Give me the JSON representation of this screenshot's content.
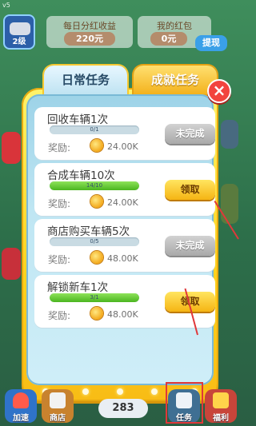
{
  "version": "v5",
  "hud": {
    "level": "2级",
    "daily_dividend_label": "每日分红收益",
    "daily_dividend_value": "220元",
    "red_packet_label": "我的红包",
    "red_packet_value": "0元",
    "withdraw_label": "提现"
  },
  "dialog": {
    "tabs": [
      {
        "label": "日常任务",
        "active": true
      },
      {
        "label": "成就任务",
        "active": false
      }
    ],
    "close_icon": "close-icon"
  },
  "tasks": [
    {
      "title": "回收车辆1次",
      "progress_text": "0/1",
      "progress": 0.0,
      "reward_label": "奖励:",
      "reward_amount": "24.00K",
      "status": "未完成",
      "claimable": false
    },
    {
      "title": "合成车辆10次",
      "progress_text": "14/10",
      "progress": 1.0,
      "reward_label": "奖励:",
      "reward_amount": "24.00K",
      "status": "领取",
      "claimable": true
    },
    {
      "title": "商店购买车辆5次",
      "progress_text": "0/5",
      "progress": 0.0,
      "reward_label": "奖励:",
      "reward_amount": "48.00K",
      "status": "未完成",
      "claimable": false
    },
    {
      "title": "解锁新车1次",
      "progress_text": "3/1",
      "progress": 1.0,
      "reward_label": "奖励:",
      "reward_amount": "48.00K",
      "status": "领取",
      "claimable": true
    }
  ],
  "bottom_bar": {
    "speedup_label": "加速",
    "shop_label": "商店",
    "center_count": "283",
    "task_label": "任务",
    "welfare_label": "福利"
  },
  "colors": {
    "accent_yellow": "#ffd21e",
    "panel_blue": "#bfe6f3",
    "annotation_red": "#e0383a"
  }
}
